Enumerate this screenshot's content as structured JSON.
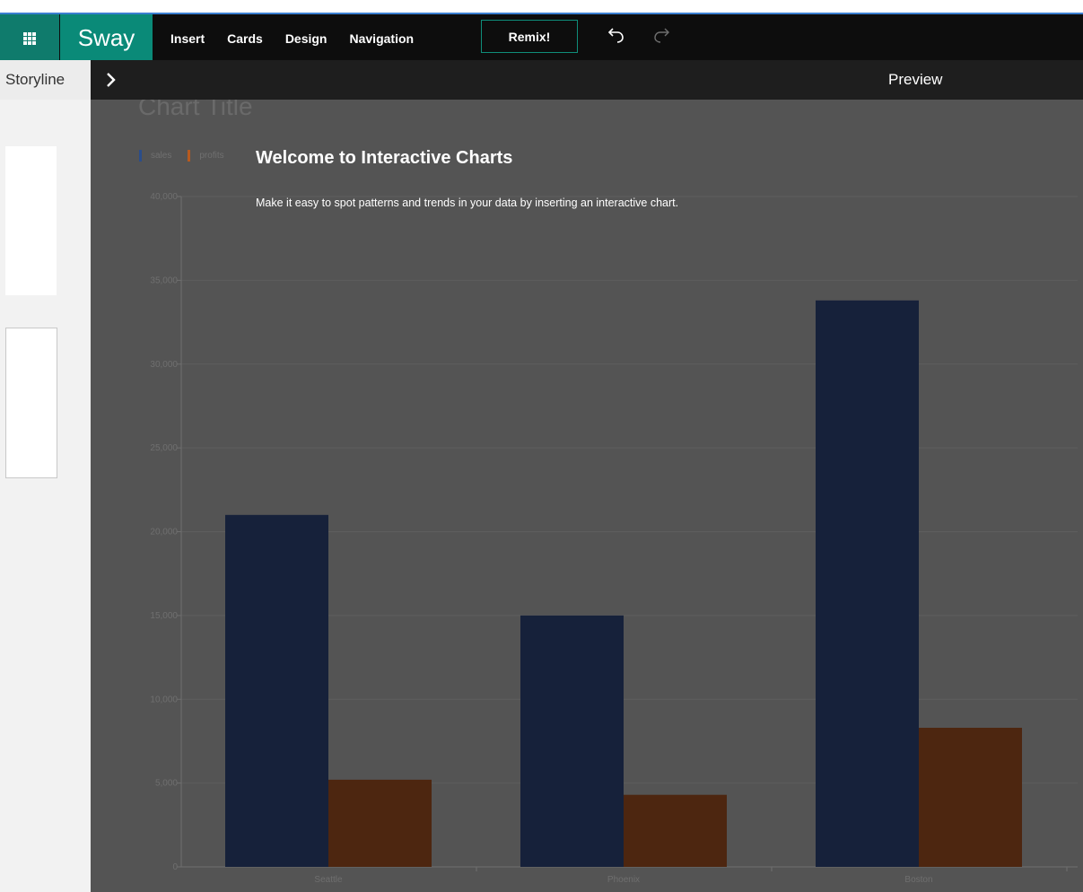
{
  "app": {
    "name": "Sway",
    "menu": [
      "Insert",
      "Cards",
      "Design",
      "Navigation"
    ],
    "remix_label": "Remix!",
    "storyline_label": "Storyline",
    "preview_label": "Preview"
  },
  "overlay": {
    "title": "Welcome to Interactive Charts",
    "description": "Make it easy to spot patterns and trends in your data by inserting an interactive chart."
  },
  "colors": {
    "accent": "#0f7b6c",
    "sales": "#16213a",
    "profits": "#4d2610"
  },
  "icons": {
    "app_launcher": "waffle-icon",
    "undo": "undo-icon",
    "redo": "redo-icon",
    "expand": "chevron-right-icon"
  },
  "chart_data": {
    "type": "bar",
    "title": "Chart Title",
    "categories": [
      "Seattle",
      "Phoenix",
      "Boston"
    ],
    "series": [
      {
        "name": "sales",
        "values": [
          21000,
          15000,
          33800
        ]
      },
      {
        "name": "profits",
        "values": [
          5200,
          4300,
          8300
        ]
      }
    ],
    "yticks": [
      "0",
      "5,000",
      "10,000",
      "15,000",
      "20,000",
      "25,000",
      "30,000",
      "35,000",
      "40,000"
    ],
    "ylim": [
      0,
      40000
    ],
    "grid": true,
    "legend": "top-left"
  }
}
